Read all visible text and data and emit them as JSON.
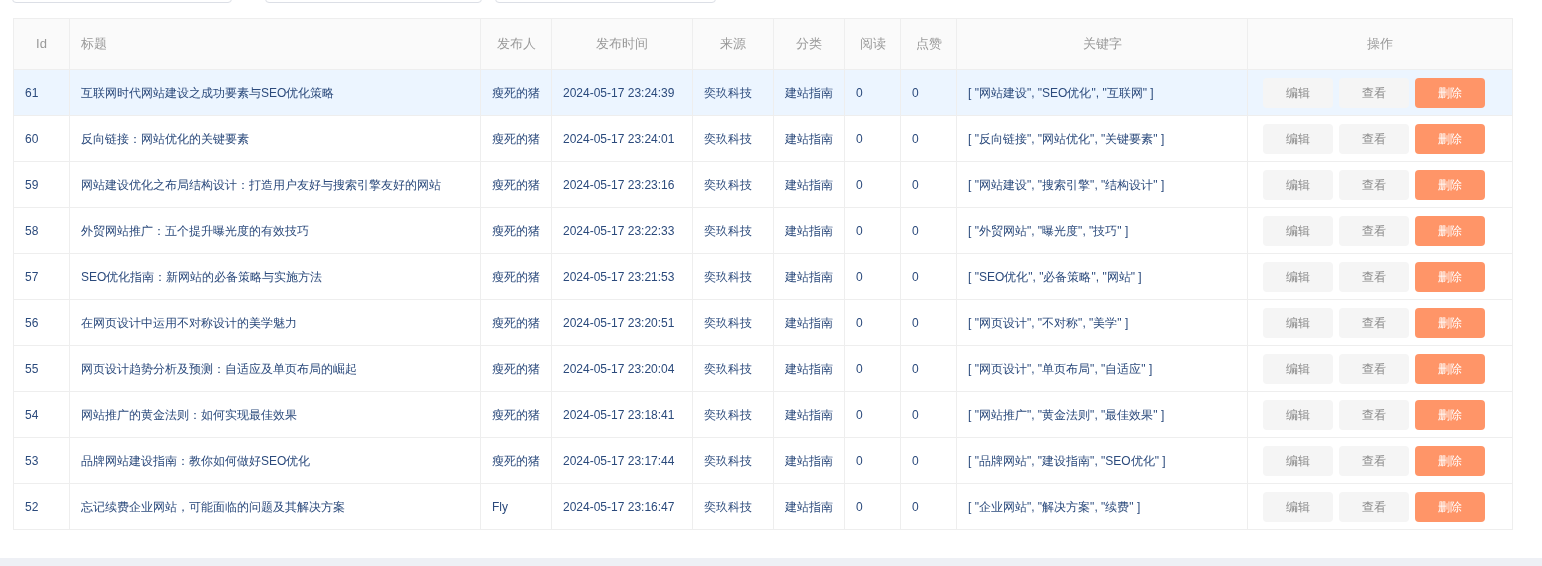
{
  "filters": [
    {
      "kind": "input"
    },
    {
      "kind": "input"
    },
    {
      "kind": "input"
    }
  ],
  "table": {
    "columns": [
      {
        "label": "Id"
      },
      {
        "label": "标题"
      },
      {
        "label": "发布人"
      },
      {
        "label": "发布时间"
      },
      {
        "label": "来源"
      },
      {
        "label": "分类"
      },
      {
        "label": "阅读"
      },
      {
        "label": "点赞"
      },
      {
        "label": "关键字"
      },
      {
        "label": "操作"
      }
    ],
    "rows": [
      {
        "selected": true,
        "cells": [
          "61",
          "互联网时代网站建设之成功要素与SEO优化策略",
          "瘦死的猪",
          "2024-05-17 23:24:39",
          "奕玖科技",
          "建站指南",
          "0",
          "0",
          "[ \"网站建设\", \"SEO优化\", \"互联网\" ]"
        ],
        "actions": [
          {
            "label": "编辑",
            "kind": "default"
          },
          {
            "label": "查看",
            "kind": "default"
          },
          {
            "label": "删除",
            "kind": "danger"
          }
        ]
      },
      {
        "selected": false,
        "cells": [
          "60",
          "反向链接：网站优化的关键要素",
          "瘦死的猪",
          "2024-05-17 23:24:01",
          "奕玖科技",
          "建站指南",
          "0",
          "0",
          "[ \"反向链接\", \"网站优化\", \"关键要素\" ]"
        ],
        "actions": [
          {
            "label": "编辑",
            "kind": "default"
          },
          {
            "label": "查看",
            "kind": "default"
          },
          {
            "label": "删除",
            "kind": "danger"
          }
        ]
      },
      {
        "selected": false,
        "cells": [
          "59",
          "网站建设优化之布局结构设计：打造用户友好与搜索引擎友好的网站",
          "瘦死的猪",
          "2024-05-17 23:23:16",
          "奕玖科技",
          "建站指南",
          "0",
          "0",
          "[ \"网站建设\", \"搜索引擎\", \"结构设计\" ]"
        ],
        "actions": [
          {
            "label": "编辑",
            "kind": "default"
          },
          {
            "label": "查看",
            "kind": "default"
          },
          {
            "label": "删除",
            "kind": "danger"
          }
        ]
      },
      {
        "selected": false,
        "cells": [
          "58",
          "外贸网站推广：五个提升曝光度的有效技巧",
          "瘦死的猪",
          "2024-05-17 23:22:33",
          "奕玖科技",
          "建站指南",
          "0",
          "0",
          "[ \"外贸网站\", \"曝光度\", \"技巧\" ]"
        ],
        "actions": [
          {
            "label": "编辑",
            "kind": "default"
          },
          {
            "label": "查看",
            "kind": "default"
          },
          {
            "label": "删除",
            "kind": "danger"
          }
        ]
      },
      {
        "selected": false,
        "cells": [
          "57",
          "SEO优化指南：新网站的必备策略与实施方法",
          "瘦死的猪",
          "2024-05-17 23:21:53",
          "奕玖科技",
          "建站指南",
          "0",
          "0",
          "[ \"SEO优化\", \"必备策略\", \"网站\" ]"
        ],
        "actions": [
          {
            "label": "编辑",
            "kind": "default"
          },
          {
            "label": "查看",
            "kind": "default"
          },
          {
            "label": "删除",
            "kind": "danger"
          }
        ]
      },
      {
        "selected": false,
        "cells": [
          "56",
          "在网页设计中运用不对称设计的美学魅力",
          "瘦死的猪",
          "2024-05-17 23:20:51",
          "奕玖科技",
          "建站指南",
          "0",
          "0",
          "[ \"网页设计\", \"不对称\", \"美学\" ]"
        ],
        "actions": [
          {
            "label": "编辑",
            "kind": "default"
          },
          {
            "label": "查看",
            "kind": "default"
          },
          {
            "label": "删除",
            "kind": "danger"
          }
        ]
      },
      {
        "selected": false,
        "cells": [
          "55",
          "网页设计趋势分析及预测：自适应及单页布局的崛起",
          "瘦死的猪",
          "2024-05-17 23:20:04",
          "奕玖科技",
          "建站指南",
          "0",
          "0",
          "[ \"网页设计\", \"单页布局\", \"自适应\" ]"
        ],
        "actions": [
          {
            "label": "编辑",
            "kind": "default"
          },
          {
            "label": "查看",
            "kind": "default"
          },
          {
            "label": "删除",
            "kind": "danger"
          }
        ]
      },
      {
        "selected": false,
        "cells": [
          "54",
          "网站推广的黄金法则：如何实现最佳效果",
          "瘦死的猪",
          "2024-05-17 23:18:41",
          "奕玖科技",
          "建站指南",
          "0",
          "0",
          "[ \"网站推广\", \"黄金法则\", \"最佳效果\" ]"
        ],
        "actions": [
          {
            "label": "编辑",
            "kind": "default"
          },
          {
            "label": "查看",
            "kind": "default"
          },
          {
            "label": "删除",
            "kind": "danger"
          }
        ]
      },
      {
        "selected": false,
        "cells": [
          "53",
          "品牌网站建设指南：教你如何做好SEO优化",
          "瘦死的猪",
          "2024-05-17 23:17:44",
          "奕玖科技",
          "建站指南",
          "0",
          "0",
          "[ \"品牌网站\", \"建设指南\", \"SEO优化\" ]"
        ],
        "actions": [
          {
            "label": "编辑",
            "kind": "default"
          },
          {
            "label": "查看",
            "kind": "default"
          },
          {
            "label": "删除",
            "kind": "danger"
          }
        ]
      },
      {
        "selected": false,
        "cells": [
          "52",
          "忘记续费企业网站，可能面临的问题及其解决方案",
          "Fly",
          "2024-05-17 23:16:47",
          "奕玖科技",
          "建站指南",
          "0",
          "0",
          "[ \"企业网站\", \"解决方案\", \"续费\" ]"
        ],
        "actions": [
          {
            "label": "编辑",
            "kind": "default"
          },
          {
            "label": "查看",
            "kind": "default"
          },
          {
            "label": "删除",
            "kind": "danger"
          }
        ]
      }
    ]
  }
}
